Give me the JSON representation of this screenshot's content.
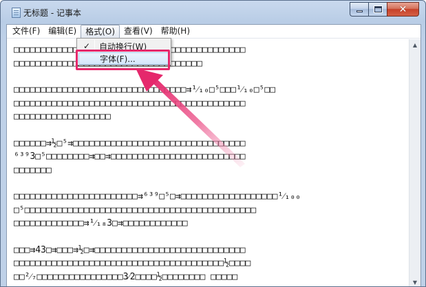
{
  "window": {
    "title": "无标题 - 记事本"
  },
  "menubar": {
    "items": [
      {
        "label": "文件(F)"
      },
      {
        "label": "编辑(E)"
      },
      {
        "label": "格式(O)"
      },
      {
        "label": "查看(V)"
      },
      {
        "label": "帮助(H)"
      }
    ]
  },
  "format_menu": {
    "word_wrap_label": "自动换行(W)",
    "word_wrap_checked": "✓",
    "font_label": "字体(F)..."
  },
  "editor": {
    "paragraphs": [
      [
        "□□□□□□□□□□□□□□□□□□□□□□□□□□□□□□□□□□□□□□□□□□□",
        "□□□□□□□□□□□□□□□□□□□□□□□□□□□□□□□□□□□"
      ],
      [
        "□□□□□□□□□□□□□□□□□□□□□□□□□□□□□□□□⇉¹⁄₁₀□⁵□□□¹⁄₁₀□⁵□□",
        "□□□□□□□□□□□□□□□□□□□□□□□□□□□□□□□□□□□□□□□□□□□",
        "□□□□□□□□□□□□□□□□□□"
      ],
      [
        "□□□□□□⇉½□⁵⇉□□□□□□□□□□□□□□□□□□□□□□□□□□□□□□□□",
        "⁶³⁹3□⁵□□□□□□□□⇉□□⇉□□□□□□□□□□□□□□□□□□□□□□□□□",
        "□□□□□□□"
      ],
      [
        "□□□□□□□□□□□□□□□□□□□□□□□⇉⁶³⁹□⁵□⇉□□□□□□□□□□□□□□□□□□¹⁄₁₀₀",
        "□⁵□□□□□□□□□□□□□□□□□□□□□□□□□□□□□□□□□□□□□□□□□□□",
        "□□□□□□□□□□□□□⇉¹⁄₁₈3□⇉□□□□□□□□□□□□"
      ],
      [
        "□□□⇉43□⇉□□□⇉½□⇉□□□□□□□□□□□□□□□□□□□□□□□□□□□□",
        "□□□□□□□□□□□□□□□□□□□□□□□□□□□□□□□□□□□□□□□½□□□□",
        "□□²⁄₇□□□□□□□□□□□□□□□□3⁄2□□□□½□□□□□□□□ □□□□□"
      ]
    ]
  },
  "colors": {
    "annotation_accent": "#e5286c",
    "titlebar": "#bfd1e8",
    "close_button": "#c74129"
  }
}
